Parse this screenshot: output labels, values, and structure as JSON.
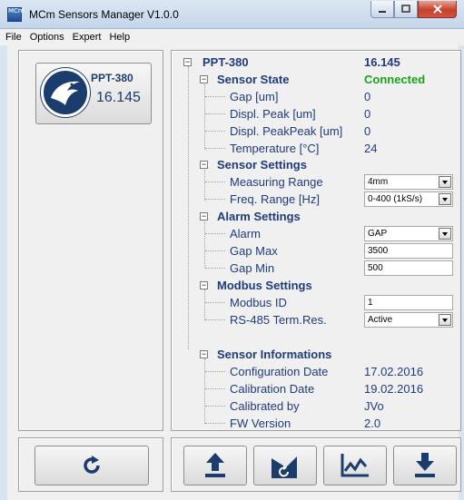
{
  "window": {
    "title": "MCm Sensors Manager V1.0.0",
    "app_icon_text": "MCm"
  },
  "menu": [
    "File",
    "Options",
    "Expert",
    "Help"
  ],
  "device_button": {
    "name": "PPT-380",
    "value": "16.145"
  },
  "tree": {
    "root": {
      "label": "PPT-380",
      "value": "16.145"
    },
    "sensor_state": {
      "label": "Sensor State",
      "value": "Connected",
      "status_color": "#18a418",
      "items": [
        {
          "label": "Gap [um]",
          "value": "0"
        },
        {
          "label": "Displ. Peak [um]",
          "value": "0"
        },
        {
          "label": "Displ. PeakPeak [um]",
          "value": "0"
        },
        {
          "label": "Temperature [°C]",
          "value": "24"
        }
      ]
    },
    "sensor_settings": {
      "label": "Sensor Settings",
      "measuring_range": {
        "label": "Measuring Range",
        "selected": "4mm"
      },
      "freq_range": {
        "label": "Freq. Range [Hz]",
        "selected": "0-400 (1kS/s)"
      }
    },
    "alarm_settings": {
      "label": "Alarm Settings",
      "alarm": {
        "label": "Alarm",
        "selected": "GAP"
      },
      "gap_max": {
        "label": "Gap Max",
        "value": "3500"
      },
      "gap_min": {
        "label": "Gap Min",
        "value": "500"
      }
    },
    "modbus_settings": {
      "label": "Modbus Settings",
      "modbus_id": {
        "label": "Modbus ID",
        "value": "1"
      },
      "term_res": {
        "label": "RS-485 Term.Res.",
        "selected": "Active"
      }
    },
    "sensor_informations": {
      "label": "Sensor Informations",
      "items": [
        {
          "label": "Configuration Date",
          "value": "17.02.2016"
        },
        {
          "label": "Calibration Date",
          "value": "19.02.2016"
        },
        {
          "label": "Calibrated by",
          "value": "JVo"
        },
        {
          "label": "FW Version",
          "value": "2.0"
        }
      ]
    }
  },
  "toolbar_icons": [
    "refresh-icon",
    "upload-icon",
    "device-refresh-icon",
    "chart-icon",
    "download-icon"
  ],
  "colors": {
    "accent": "#1b3d6d",
    "tree_text": "#1f3b7a"
  }
}
